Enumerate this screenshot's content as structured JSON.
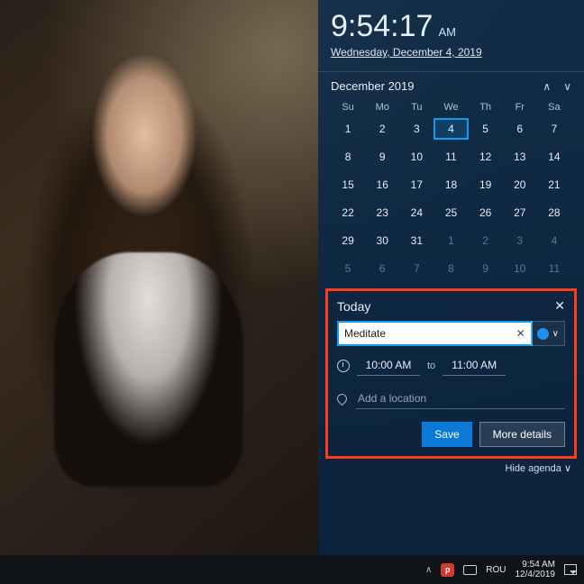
{
  "clock": {
    "time": "9:54:17",
    "ampm": "AM",
    "date_full": "Wednesday, December 4, 2019"
  },
  "calendar": {
    "month_label": "December 2019",
    "dow": [
      "Su",
      "Mo",
      "Tu",
      "We",
      "Th",
      "Fr",
      "Sa"
    ],
    "cells": [
      {
        "n": "1"
      },
      {
        "n": "2"
      },
      {
        "n": "3"
      },
      {
        "n": "4",
        "today": true
      },
      {
        "n": "5"
      },
      {
        "n": "6"
      },
      {
        "n": "7"
      },
      {
        "n": "8"
      },
      {
        "n": "9"
      },
      {
        "n": "10"
      },
      {
        "n": "11"
      },
      {
        "n": "12"
      },
      {
        "n": "13"
      },
      {
        "n": "14"
      },
      {
        "n": "15"
      },
      {
        "n": "16"
      },
      {
        "n": "17"
      },
      {
        "n": "18"
      },
      {
        "n": "19"
      },
      {
        "n": "20"
      },
      {
        "n": "21"
      },
      {
        "n": "22"
      },
      {
        "n": "23"
      },
      {
        "n": "24"
      },
      {
        "n": "25"
      },
      {
        "n": "26"
      },
      {
        "n": "27"
      },
      {
        "n": "28"
      },
      {
        "n": "29"
      },
      {
        "n": "30"
      },
      {
        "n": "31"
      },
      {
        "n": "1",
        "dim": true
      },
      {
        "n": "2",
        "dim": true
      },
      {
        "n": "3",
        "dim": true
      },
      {
        "n": "4",
        "dim": true
      },
      {
        "n": "5",
        "dim": true
      },
      {
        "n": "6",
        "dim": true
      },
      {
        "n": "7",
        "dim": true
      },
      {
        "n": "8",
        "dim": true
      },
      {
        "n": "9",
        "dim": true
      },
      {
        "n": "10",
        "dim": true
      },
      {
        "n": "11",
        "dim": true
      }
    ]
  },
  "agenda": {
    "heading": "Today",
    "event_title": "Meditate",
    "start_time": "10:00 AM",
    "to_label": "to",
    "end_time": "11:00 AM",
    "location_placeholder": "Add a location",
    "save_label": "Save",
    "more_label": "More details",
    "hide_label": "Hide agenda",
    "color_hex": "#1f8ff0"
  },
  "taskbar": {
    "lang": "ROU",
    "time": "9:54 AM",
    "date": "12/4/2019"
  }
}
